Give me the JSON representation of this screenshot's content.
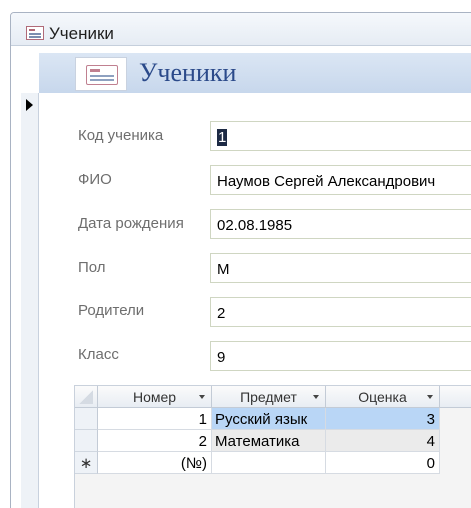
{
  "window": {
    "title": "Ученики"
  },
  "header": {
    "title": "Ученики"
  },
  "fields": {
    "student_id": {
      "label": "Код ученика",
      "value": "1"
    },
    "full_name": {
      "label": "ФИО",
      "value": "Наумов Сергей Александрович"
    },
    "birth_date": {
      "label": "Дата рождения",
      "value": "02.08.1985"
    },
    "gender": {
      "label": "Пол",
      "value": "М"
    },
    "parents": {
      "label": "Родители",
      "value": "2"
    },
    "class": {
      "label": "Класс",
      "value": "9"
    }
  },
  "subform": {
    "columns": [
      "Номер",
      "Предмет",
      "Оценка"
    ],
    "rows": [
      {
        "number": "1",
        "subject": "Русский язык",
        "grade": "3"
      },
      {
        "number": "2",
        "subject": "Математика",
        "grade": "4"
      }
    ],
    "new_row": {
      "marker": "∗",
      "number": "(№)",
      "subject": "",
      "grade": "0"
    }
  }
}
